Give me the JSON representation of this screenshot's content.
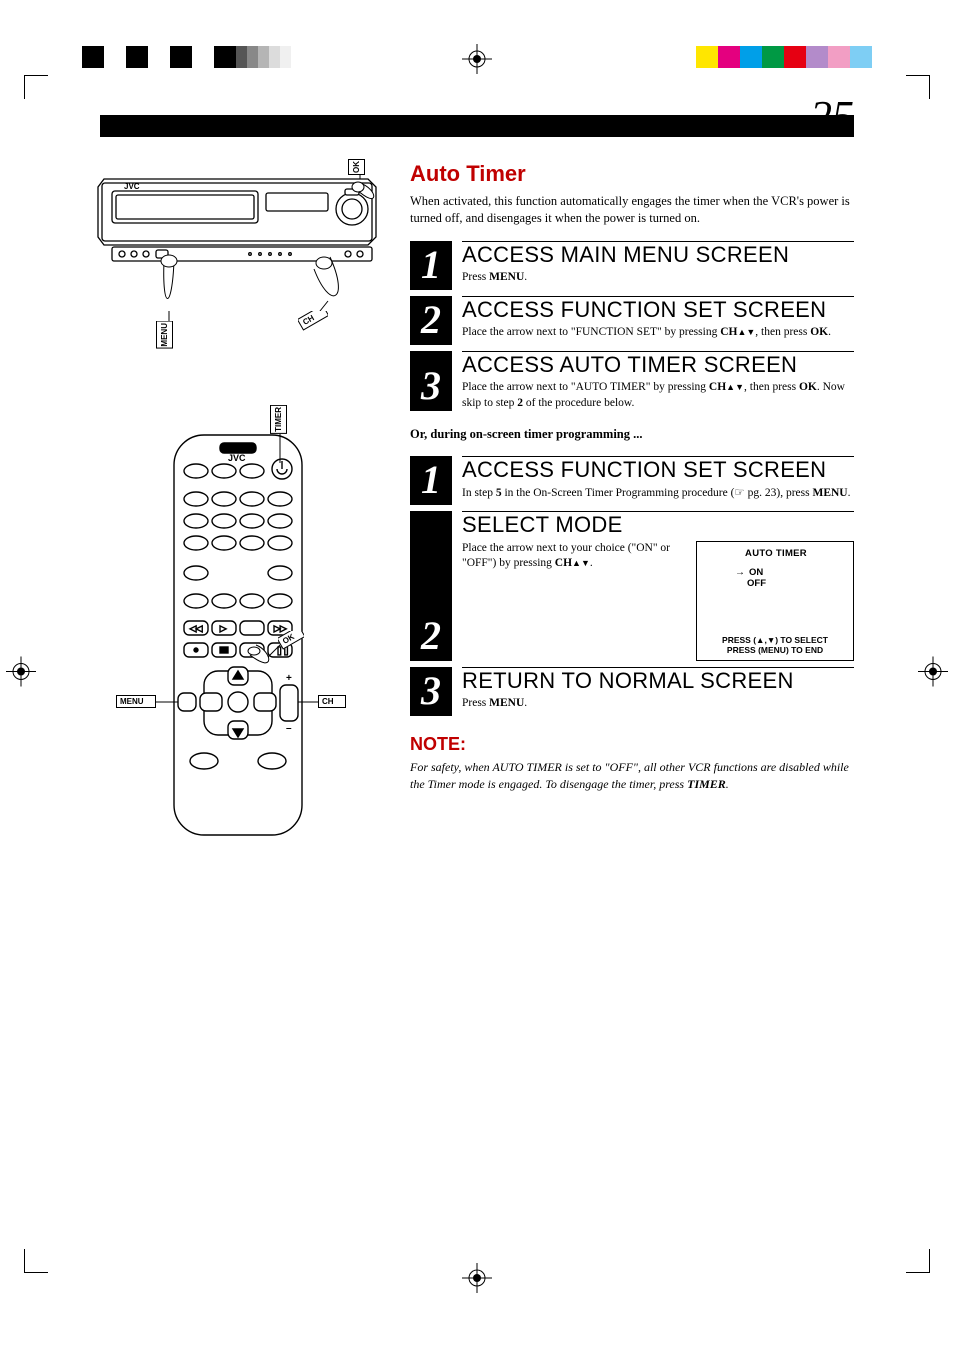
{
  "page_number": "25",
  "section_title": "Auto Timer",
  "intro": "When activated, this function automatically engages the timer when the VCR's power is turned off, and disengages it when the power is turned on.",
  "stepsA": [
    {
      "num": "1",
      "title": "ACCESS MAIN MENU SCREEN",
      "parts": [
        "Press ",
        "MENU",
        "."
      ]
    },
    {
      "num": "2",
      "title": "ACCESS FUNCTION SET SCREEN",
      "parts": [
        "Place the arrow next to \"FUNCTION SET\" by pressing ",
        "CH",
        "▲▼",
        ", then press ",
        "OK",
        "."
      ]
    },
    {
      "num": "3",
      "title": "ACCESS AUTO TIMER SCREEN",
      "parts": [
        "Place the arrow next to \"AUTO TIMER\" by pressing ",
        "CH",
        "▲▼",
        ", then press ",
        "OK",
        ". Now skip to step ",
        "2",
        " of the procedure below."
      ]
    }
  ],
  "between_text": "Or, during on-screen timer programming ...",
  "stepsB": [
    {
      "num": "1",
      "title": "ACCESS FUNCTION SET SCREEN",
      "parts": [
        "In step ",
        "5",
        " in the On-Screen Timer Programming procedure (☞ pg. 23), press ",
        "MENU",
        "."
      ]
    },
    {
      "num": "2",
      "title": "SELECT MODE",
      "parts": [
        "Place the arrow next to your choice (\"ON\" or \"OFF\") by pressing ",
        "CH",
        "▲▼",
        "."
      ]
    },
    {
      "num": "3",
      "title": "RETURN TO NORMAL SCREEN",
      "parts": [
        "Press ",
        "MENU",
        "."
      ]
    }
  ],
  "osd": {
    "title": "AUTO TIMER",
    "options": [
      "ON",
      "OFF"
    ],
    "selected_index": 0,
    "footer_line1": "PRESS (▲,▼) TO SELECT",
    "footer_line2": "PRESS (MENU) TO END"
  },
  "note": {
    "heading": "NOTE:",
    "body_pre": "For safety, when AUTO TIMER is set to \"OFF\", all other VCR functions are disabled while the Timer mode is engaged. To disengage the timer, press ",
    "body_key": "TIMER",
    "body_post": "."
  },
  "diagram_vcr": {
    "brand": "JVC",
    "callouts": {
      "menu": "MENU",
      "ch": "CH",
      "ok": "OK"
    }
  },
  "diagram_remote": {
    "brand": "JVC",
    "callouts": {
      "timer": "TIMER",
      "ok": "OK",
      "menu": "MENU",
      "ch": "CH"
    },
    "plusminus": {
      "plus": "+",
      "minus": "–"
    }
  },
  "reg_colors_left": [
    "#000000",
    "#000000",
    "#000000",
    "#000000"
  ],
  "reg_greys_left": [
    "#555555",
    "#888888",
    "#b5b5b5",
    "#dcdcdc"
  ],
  "reg_colors_right": [
    "#ffe600",
    "#e4007f",
    "#009fe8",
    "#009944",
    "#e60012",
    "#b38bca",
    "#f29ec4",
    "#7ecef4"
  ]
}
